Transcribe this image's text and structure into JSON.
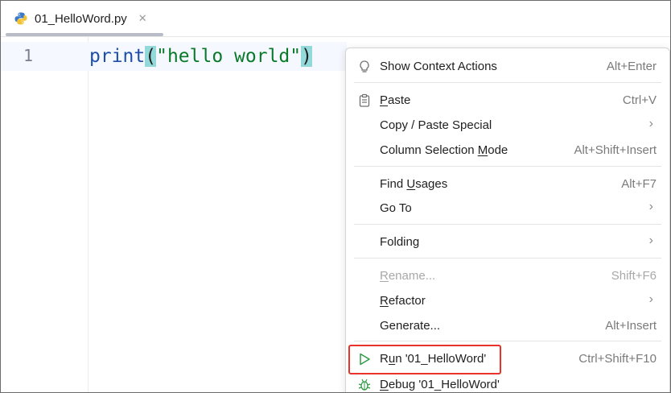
{
  "tab": {
    "file_name": "01_HelloWord.py",
    "close_glyph": "✕",
    "icon": "python-file-icon"
  },
  "editor": {
    "line_number": "1",
    "code": {
      "fn": "print",
      "open_paren": "(",
      "string": "\"hello world\"",
      "close_paren": ")"
    }
  },
  "menu": {
    "items": [
      {
        "name": "show-context-actions",
        "label": "Show Context Actions",
        "mnemonic_prefix": "",
        "mnemonic": "",
        "mnemonic_suffix": "",
        "shortcut": "Alt+Enter",
        "icon": "bulb-icon"
      },
      {
        "name": "paste",
        "label": "Paste",
        "mnemonic_prefix": "",
        "mnemonic": "P",
        "mnemonic_suffix": "aste",
        "shortcut": "Ctrl+V",
        "icon": "clipboard-icon"
      },
      {
        "name": "copy-paste-special",
        "label": "Copy / Paste Special",
        "shortcut": "",
        "submenu": true
      },
      {
        "name": "column-selection-mode",
        "label_prefix": "Column Selection ",
        "mnemonic": "M",
        "label_suffix": "ode",
        "shortcut": "Alt+Shift+Insert"
      },
      {
        "name": "find-usages",
        "label_prefix": "Find ",
        "mnemonic": "U",
        "label_suffix": "sages",
        "shortcut": "Alt+F7"
      },
      {
        "name": "go-to",
        "label": "Go To",
        "shortcut": "",
        "submenu": true
      },
      {
        "name": "folding",
        "label": "Folding",
        "shortcut": "",
        "submenu": true
      },
      {
        "name": "rename",
        "label_prefix": "",
        "mnemonic": "R",
        "label_suffix": "ename...",
        "shortcut": "Shift+F6",
        "disabled": true
      },
      {
        "name": "refactor",
        "label_prefix": "",
        "mnemonic": "R",
        "label_suffix": "efactor",
        "shortcut": "",
        "submenu": true
      },
      {
        "name": "generate",
        "label": "Generate...",
        "shortcut": "Alt+Insert"
      },
      {
        "name": "run",
        "label_prefix": "R",
        "mnemonic": "u",
        "label_suffix": "n '01_HelloWord'",
        "shortcut": "Ctrl+Shift+F10",
        "icon": "run-icon"
      },
      {
        "name": "debug",
        "label_prefix": "",
        "mnemonic": "D",
        "label_suffix": "ebug '01_HelloWord'",
        "shortcut": "",
        "icon": "debug-icon"
      }
    ],
    "submenu_glyph": "›"
  },
  "colors": {
    "run_icon": "#2e9b45",
    "highlight_border": "#e8322a",
    "string": "#0a7a2a",
    "keyword_fn": "#1d4fa8",
    "paren_bg": "#93d9d9"
  }
}
